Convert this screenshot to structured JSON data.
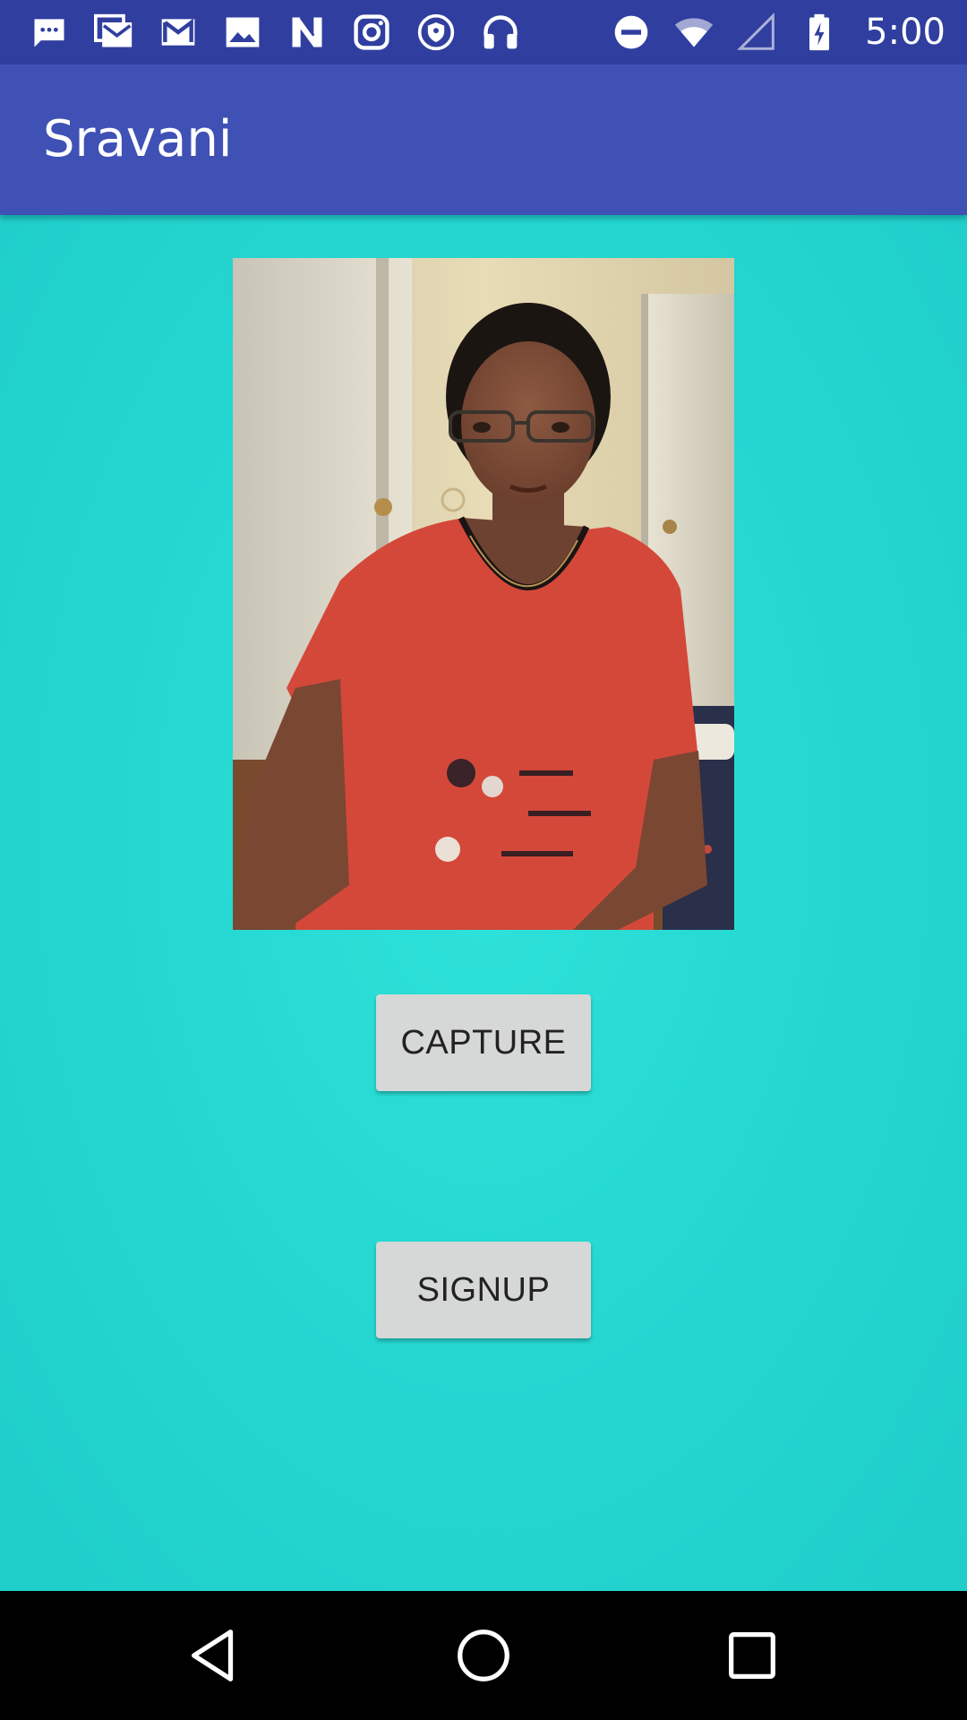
{
  "status_bar": {
    "time": "5:00",
    "left_icons": [
      "sms-icon",
      "gmail-icon",
      "gmail-icon",
      "image-icon",
      "n-app-icon",
      "instagram-icon",
      "vpn-shield-icon",
      "headphones-icon"
    ],
    "right_icons": [
      "do-not-disturb-icon",
      "wifi-icon",
      "cell-signal-icon",
      "battery-charging-icon"
    ],
    "background_color": "#303f9f"
  },
  "app_bar": {
    "title": "Sravani",
    "background_color": "#3f51b5"
  },
  "content": {
    "background_color": "#25d8d2",
    "photo": {
      "alt": "captured-selfie-photo"
    },
    "capture_button": {
      "label": "CAPTURE"
    },
    "signup_button": {
      "label": "SIGNUP"
    }
  },
  "nav_bar": {
    "icons": [
      "back-icon",
      "home-icon",
      "recents-icon"
    ]
  }
}
